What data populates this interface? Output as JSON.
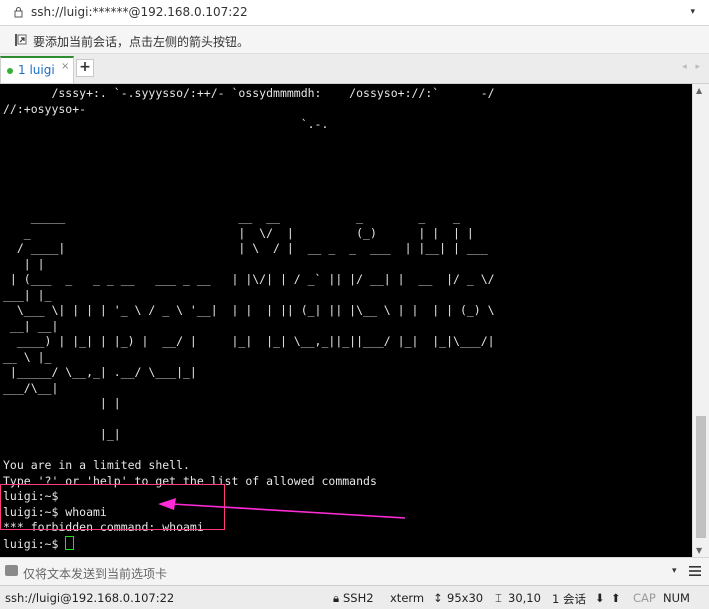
{
  "address": {
    "url": "ssh://luigi:******@192.168.0.107:22",
    "dropdown": "▾"
  },
  "hint": {
    "text": "要添加当前会话，点击左侧的箭头按钮。"
  },
  "tabs": {
    "items": [
      {
        "label": "1 luigi",
        "close": "×"
      }
    ],
    "add": "+",
    "nav": "◂ ▸"
  },
  "terminal": {
    "lines": [
      "       /sssy+:. `-.syyysso/:++/- `ossydmmmmdh:    /ossyso+://:`      -/",
      "//:+osyyso+-",
      "                                           `.-.",
      "",
      "",
      "",
      "",
      "",
      "    _____                         __  __           _        _    _",
      "   _                              |  \\/  |         (_)      | |  | |",
      "  / ____|                         | \\  / |  __ _  _  ___  | |__| | ___",
      "   | |",
      " | (___  _   _ _ __   ___ _ __   | |\\/| | / _` || |/ __| |  __  |/ _ \\/",
      "___| |_",
      "  \\___ \\| | | | '_ \\ / _ \\ '__|  | |  | || (_| || |\\__ \\ | |  | | (_) \\",
      " __| __|",
      "  ____) | |_| | |_) |  __/ |     |_|  |_| \\__,_||_||___/ |_|  |_|\\___/|",
      "__ \\ |_",
      " |_____/ \\__,_| .__/ \\___|_|",
      "___/\\__|",
      "              | |",
      "",
      "              |_|",
      "",
      "You are in a limited shell.",
      "Type '?' or 'help' to get the list of allowed commands",
      "luigi:~$",
      "luigi:~$ whoami",
      "*** forbidden command: whoami",
      "luigi:~$ "
    ]
  },
  "sendbar": {
    "text": "仅将文本发送到当前选项卡",
    "dropdown": "▾"
  },
  "status": {
    "connection": "ssh://luigi@192.168.0.107:22",
    "protocol": "SSH2",
    "term_type": "xterm",
    "size": "95x30",
    "cursor_pos": "30,10",
    "sessions": "1 会话",
    "caps": "CAP",
    "num": "NUM"
  },
  "colors": {
    "highlight": "#ff3c7d",
    "arrow": "#ff2bd6",
    "cursor": "#19e019",
    "terminal_bg": "#000000"
  }
}
